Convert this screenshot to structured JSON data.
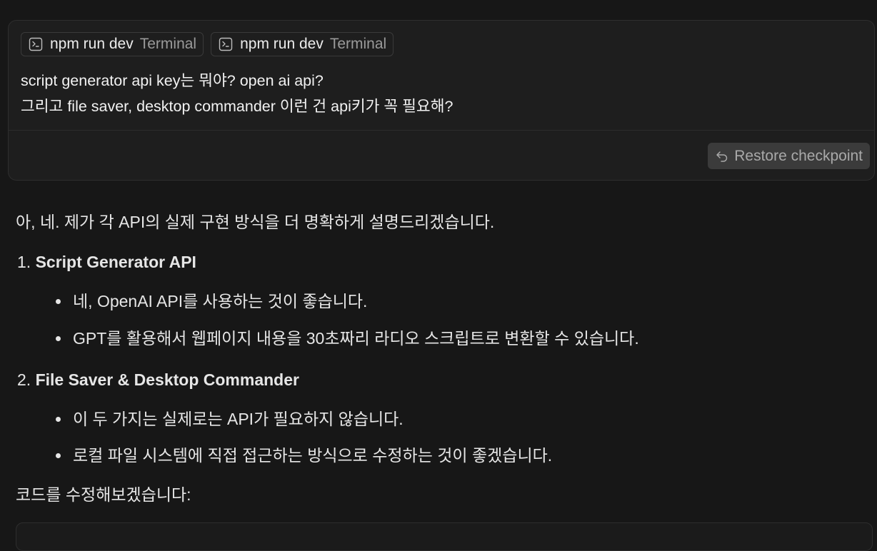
{
  "user_message": {
    "context_chips": [
      {
        "command": "npm run dev",
        "kind": "Terminal",
        "icon": "terminal-icon"
      },
      {
        "command": "npm run dev",
        "kind": "Terminal",
        "icon": "terminal-icon"
      }
    ],
    "lines": [
      "script generator api key는 뭐야? open ai api?",
      "그리고 file saver, desktop commander 이런 건 api키가 꼭 필요해?"
    ],
    "restore_button": {
      "label": "Restore checkpoint",
      "icon": "undo-icon"
    }
  },
  "response": {
    "intro": "아, 네. 제가 각 API의 실제 구현 방식을 더 명확하게 설명드리겠습니다.",
    "sections": [
      {
        "number": "1.",
        "title": "Script Generator API",
        "bullets": [
          "네, OpenAI API를 사용하는 것이 좋습니다.",
          "GPT를 활용해서 웹페이지 내용을 30초짜리 라디오 스크립트로 변환할 수 있습니다."
        ]
      },
      {
        "number": "2.",
        "title": "File Saver & Desktop Commander",
        "bullets": [
          "이 두 가지는 실제로는 API가 필요하지 않습니다.",
          "로컬 파일 시스템에 직접 접근하는 방식으로 수정하는 것이 좋겠습니다."
        ]
      }
    ],
    "outro": "코드를 수정해보겠습니다:"
  },
  "colors": {
    "background": "#171717",
    "card_background": "#1e1e1e",
    "button_background": "#3b3b3b",
    "muted_text": "#9a9a9a"
  }
}
